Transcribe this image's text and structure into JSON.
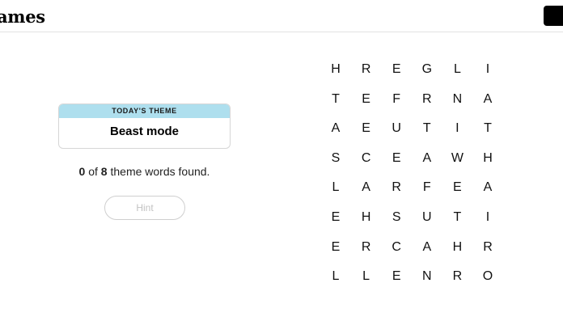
{
  "header": {
    "brand": "ames"
  },
  "theme": {
    "label": "TODAY'S THEME",
    "title": "Beast mode"
  },
  "progress": {
    "found": "0",
    "of_text": " of ",
    "total": "8",
    "suffix": " theme words found."
  },
  "hint": {
    "label": "Hint"
  },
  "grid": {
    "rows": [
      [
        "H",
        "R",
        "E",
        "G",
        "L",
        "I"
      ],
      [
        "T",
        "E",
        "F",
        "R",
        "N",
        "A"
      ],
      [
        "A",
        "E",
        "U",
        "T",
        "I",
        "T"
      ],
      [
        "S",
        "C",
        "E",
        "A",
        "W",
        "H"
      ],
      [
        "L",
        "A",
        "R",
        "F",
        "E",
        "A"
      ],
      [
        "E",
        "H",
        "S",
        "U",
        "T",
        "I"
      ],
      [
        "E",
        "R",
        "C",
        "A",
        "H",
        "R"
      ],
      [
        "L",
        "L",
        "E",
        "N",
        "R",
        "O"
      ]
    ]
  }
}
